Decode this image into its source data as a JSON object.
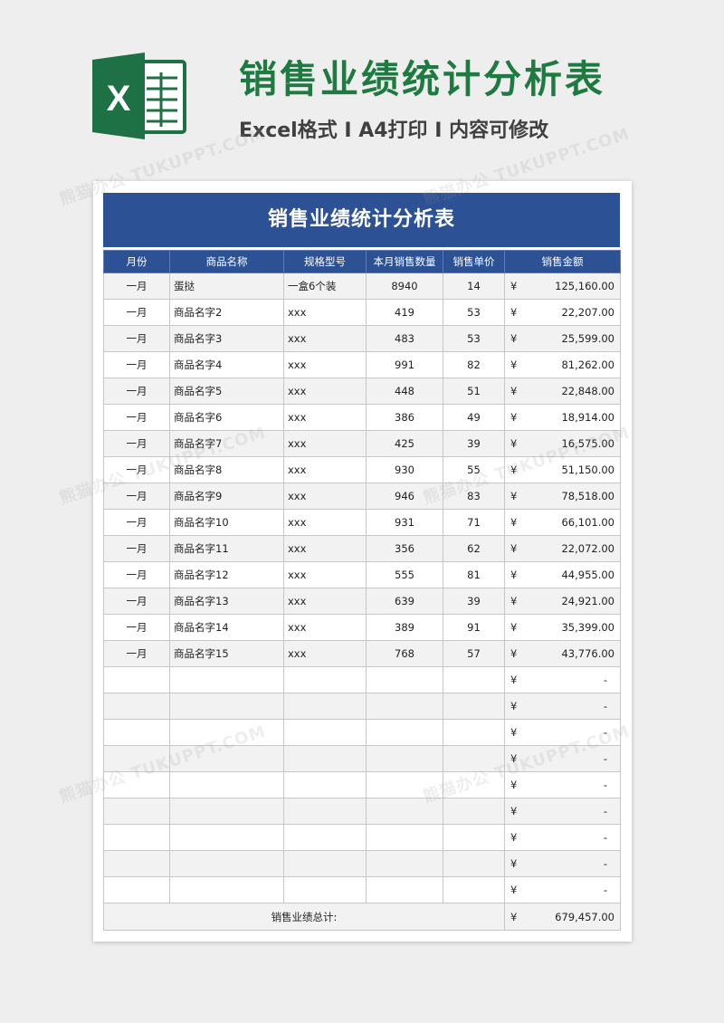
{
  "banner": {
    "title": "销售业绩统计分析表",
    "subtitle": "Excel格式 I A4打印 I 内容可修改",
    "logo_letter": "X"
  },
  "document": {
    "title": "销售业绩统计分析表",
    "columns": [
      "月份",
      "商品名称",
      "规格型号",
      "本月销售数量",
      "销售单价",
      "销售金额"
    ],
    "currency_symbol": "¥",
    "rows": [
      {
        "month": "一月",
        "name": "蛋挞",
        "spec": "一盒6个装",
        "qty": "8940",
        "price": "14",
        "amount": "125,160.00"
      },
      {
        "month": "一月",
        "name": "商品名字2",
        "spec": "xxx",
        "qty": "419",
        "price": "53",
        "amount": "22,207.00"
      },
      {
        "month": "一月",
        "name": "商品名字3",
        "spec": "xxx",
        "qty": "483",
        "price": "53",
        "amount": "25,599.00"
      },
      {
        "month": "一月",
        "name": "商品名字4",
        "spec": "xxx",
        "qty": "991",
        "price": "82",
        "amount": "81,262.00"
      },
      {
        "month": "一月",
        "name": "商品名字5",
        "spec": "xxx",
        "qty": "448",
        "price": "51",
        "amount": "22,848.00"
      },
      {
        "month": "一月",
        "name": "商品名字6",
        "spec": "xxx",
        "qty": "386",
        "price": "49",
        "amount": "18,914.00"
      },
      {
        "month": "一月",
        "name": "商品名字7",
        "spec": "xxx",
        "qty": "425",
        "price": "39",
        "amount": "16,575.00"
      },
      {
        "month": "一月",
        "name": "商品名字8",
        "spec": "xxx",
        "qty": "930",
        "price": "55",
        "amount": "51,150.00"
      },
      {
        "month": "一月",
        "name": "商品名字9",
        "spec": "xxx",
        "qty": "946",
        "price": "83",
        "amount": "78,518.00"
      },
      {
        "month": "一月",
        "name": "商品名字10",
        "spec": "xxx",
        "qty": "931",
        "price": "71",
        "amount": "66,101.00"
      },
      {
        "month": "一月",
        "name": "商品名字11",
        "spec": "xxx",
        "qty": "356",
        "price": "62",
        "amount": "22,072.00"
      },
      {
        "month": "一月",
        "name": "商品名字12",
        "spec": "xxx",
        "qty": "555",
        "price": "81",
        "amount": "44,955.00"
      },
      {
        "month": "一月",
        "name": "商品名字13",
        "spec": "xxx",
        "qty": "639",
        "price": "39",
        "amount": "24,921.00"
      },
      {
        "month": "一月",
        "name": "商品名字14",
        "spec": "xxx",
        "qty": "389",
        "price": "91",
        "amount": "35,399.00"
      },
      {
        "month": "一月",
        "name": "商品名字15",
        "spec": "xxx",
        "qty": "768",
        "price": "57",
        "amount": "43,776.00"
      },
      {
        "month": "",
        "name": "",
        "spec": "",
        "qty": "",
        "price": "",
        "amount": "-"
      },
      {
        "month": "",
        "name": "",
        "spec": "",
        "qty": "",
        "price": "",
        "amount": "-"
      },
      {
        "month": "",
        "name": "",
        "spec": "",
        "qty": "",
        "price": "",
        "amount": "-"
      },
      {
        "month": "",
        "name": "",
        "spec": "",
        "qty": "",
        "price": "",
        "amount": "-"
      },
      {
        "month": "",
        "name": "",
        "spec": "",
        "qty": "",
        "price": "",
        "amount": "-"
      },
      {
        "month": "",
        "name": "",
        "spec": "",
        "qty": "",
        "price": "",
        "amount": "-"
      },
      {
        "month": "",
        "name": "",
        "spec": "",
        "qty": "",
        "price": "",
        "amount": "-"
      },
      {
        "month": "",
        "name": "",
        "spec": "",
        "qty": "",
        "price": "",
        "amount": "-"
      },
      {
        "month": "",
        "name": "",
        "spec": "",
        "qty": "",
        "price": "",
        "amount": "-"
      }
    ],
    "total_label": "销售业绩总计:",
    "total_amount": "679,457.00"
  },
  "watermark": "熊猫办公 TUKUPPT.COM",
  "colors": {
    "brand_green": "#1f7a42",
    "header_blue": "#2d5195",
    "stripe_gray": "#f2f2f2"
  },
  "icons": [
    "excel-logo-icon"
  ]
}
